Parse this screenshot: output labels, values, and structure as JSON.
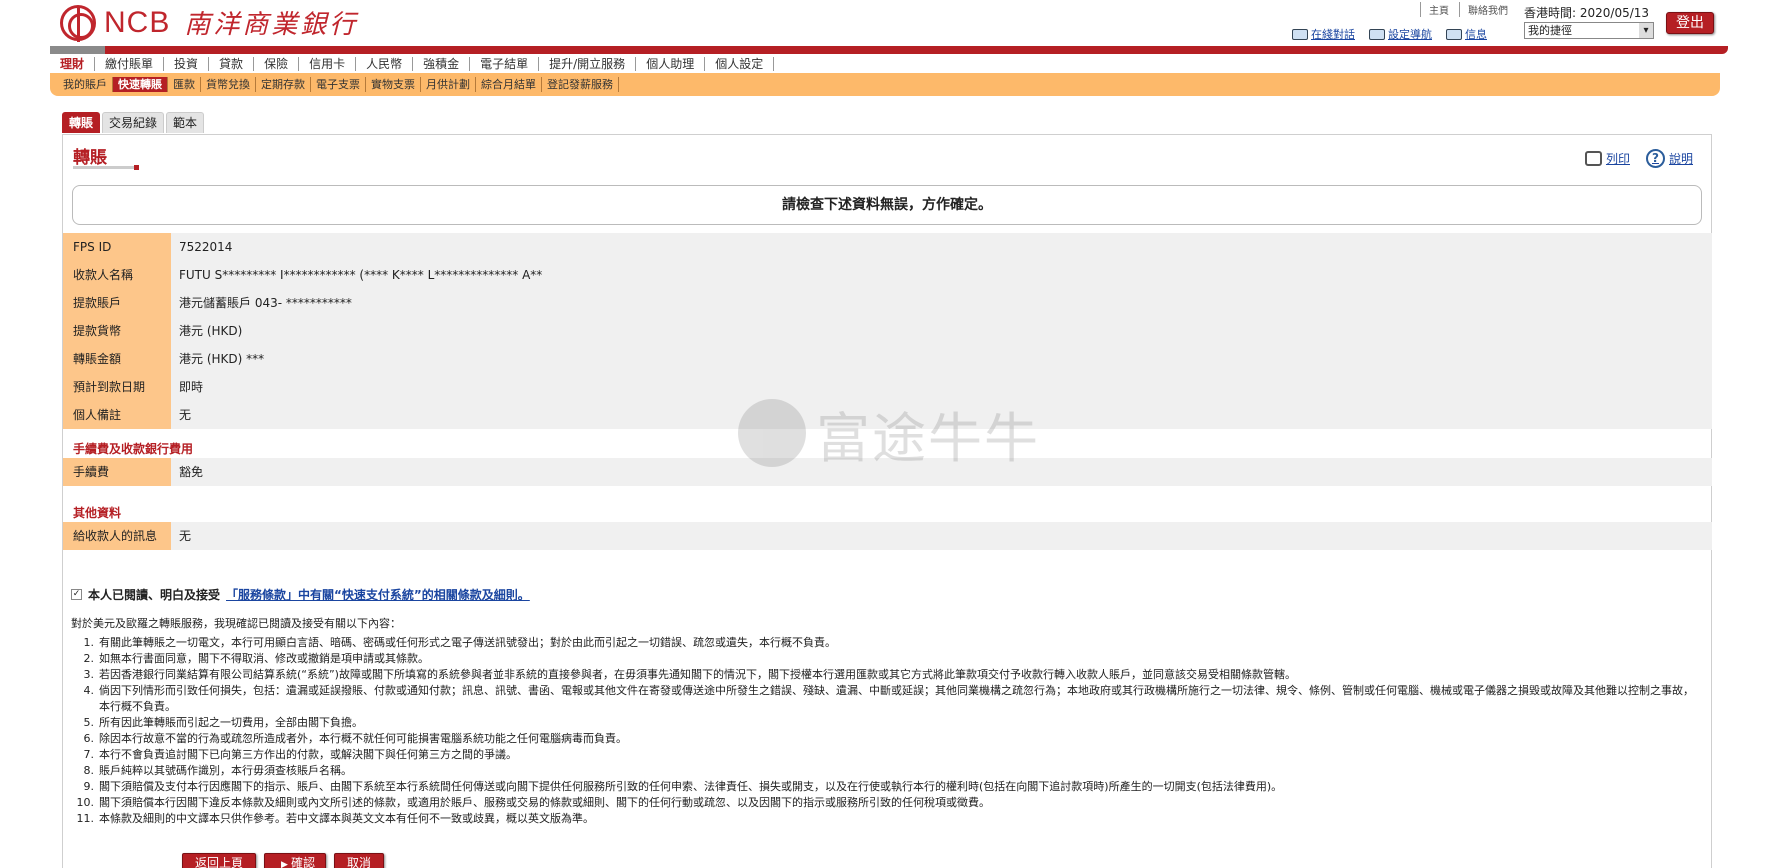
{
  "header": {
    "logo_en": "NCB",
    "logo_zh": "南洋商業銀行",
    "top_links": [
      "主頁",
      "聯絡我們"
    ],
    "hk_time_label": "香港時間: 2020/05/13",
    "logout": "登出",
    "shortcuts": [
      "在綫對話",
      "設定導航",
      "信息"
    ],
    "my_shortcut_select": "我的捷徑"
  },
  "nav": {
    "main": [
      "理財",
      "繳付賬單",
      "投資",
      "貸款",
      "保險",
      "信用卡",
      "人民幣",
      "強積金",
      "電子結單",
      "提升/開立服務",
      "個人助理",
      "個人設定"
    ],
    "sub": [
      "我的賬戶",
      "快速轉賬",
      "匯款",
      "貨幣兌換",
      "定期存款",
      "電子支票",
      "實物支票",
      "月供計劃",
      "綜合月結單",
      "登記發薪服務"
    ]
  },
  "tabs": [
    "轉賬",
    "交易紀錄",
    "範本"
  ],
  "page": {
    "title": "轉賬",
    "print": "列印",
    "help": "說明",
    "notice": "請檢查下述資料無誤，方作確定。"
  },
  "details": [
    {
      "label": "FPS ID",
      "value": "7522014"
    },
    {
      "label": "收款人名稱",
      "value": "FUTU S********* I************ (**** K**** L************** A**"
    },
    {
      "label": "提款賬戶",
      "value": "港元儲蓄賬戶 043-  ***********"
    },
    {
      "label": "提款貨幣",
      "value": "港元 (HKD)"
    },
    {
      "label": "轉賬金額",
      "value": "港元 (HKD)  ***"
    },
    {
      "label": "預計到款日期",
      "value": "即時"
    },
    {
      "label": "個人備註",
      "value": "无"
    }
  ],
  "fees": {
    "heading": "手續費及收款銀行費用",
    "label": "手續費",
    "value": "豁免"
  },
  "other": {
    "heading": "其他資料",
    "label": "給收款人的訊息",
    "value": "无"
  },
  "watermark": "富途牛牛",
  "agreement": {
    "prefix": "本人已閱讀、明白及接受",
    "link": "「服務條款」中有關“快速支付系統”的相關條款及細則。",
    "checked": true
  },
  "terms_intro": "對於美元及歐羅之轉賬服務，我現確認已閱讀及接受有關以下內容：",
  "terms": [
    "有關此筆轉賬之一切電文，本行可用顯白言語、暗碼、密碼或任何形式之電子傳送訊號發出；對於由此而引起之一切錯誤、疏忽或遺失，本行概不負責。",
    "如無本行書面同意，閣下不得取消、修改或撤銷是項申請或其條款。",
    "若因香港銀行同業結算有限公司結算系統(“系統”)故障或閣下所填寫的系統參與者並非系統的直接參與者，在毋須事先通知閣下的情況下，閣下授權本行選用匯款或其它方式將此筆款項交付予收款行轉入收款人賬戶，並同意該交易受相關條款管轄。",
    "倘因下列情形而引致任何損失，包括：遺漏或延誤撥賬、付款或通知付款；訊息、訊號、書函、電報或其他文件在寄發或傳送途中所發生之錯誤、殘缺、遺漏、中斷或延誤；其他同業機構之疏忽行為；本地政府或其行政機構所施行之一切法律、規令、條例、管制或任何電腦、機械或電子儀器之損毀或故障及其他難以控制之事故，本行概不負責。",
    "所有因此筆轉賬而引起之一切費用，全部由閣下負擔。",
    "除因本行故意不當的行為或疏忽所造成者外，本行概不就任何可能損害電腦系統功能之任何電腦病毒而負責。",
    "本行不會負責追討閣下已向第三方作出的付款，或解決閣下與任何第三方之間的爭議。",
    "賬戶純粹以其號碼作識別，本行毋須查核賬戶名稱。",
    "閣下須賠償及支付本行因應閣下的指示、賬戶、由閣下系統至本行系統間任何傳送或向閣下提供任何服務所引致的任何申索、法律責任、損失或開支，以及在行使或執行本行的權利時(包括在向閣下追討款項時)所產生的一切開支(包括法律費用)。",
    "閣下須賠償本行因閣下違反本條款及細則或內文所引述的條款，或適用於賬戶、服務或交易的條款或細則、閣下的任何行動或疏忽、以及因閣下的指示或服務所引致的任何稅項或徵費。",
    "本條款及細則的中文譯本只供作參考。若中文譯本與英文文本有任何不一致或歧異，概以英文版為準。"
  ],
  "buttons": {
    "back": "返回上頁",
    "confirm": "確認",
    "cancel": "取消"
  }
}
